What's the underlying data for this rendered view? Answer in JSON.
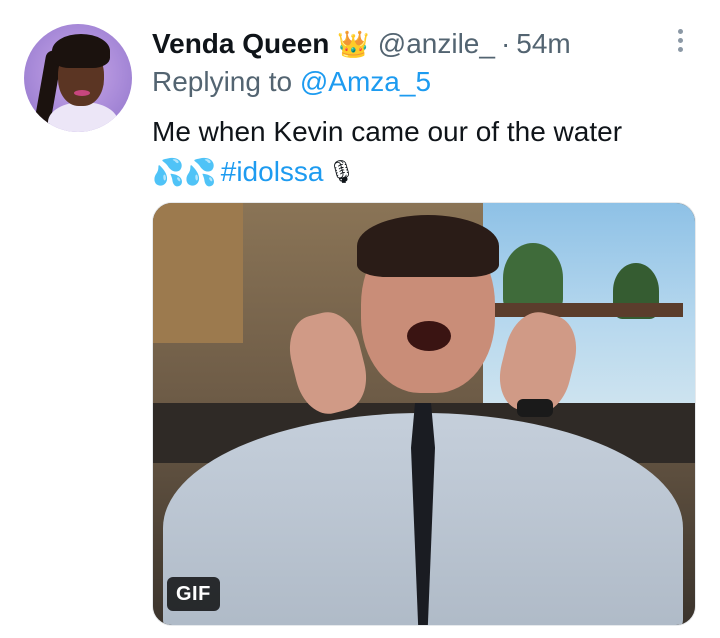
{
  "tweet": {
    "author_name": "Venda Queen",
    "author_badge_emoji": "👑",
    "handle": "@anzile_",
    "separator": "·",
    "time": "54m",
    "replying_prefix": "Replying to",
    "replying_to": "@Amza_5",
    "text_line1": "Me when Kevin came our of the water",
    "emoji_drops": "💦💦",
    "hashtag": "#idolssa",
    "emoji_mic": "🎙",
    "media": {
      "badge": "GIF"
    }
  },
  "icons": {
    "more": "more-vertical-icon",
    "avatar": "avatar-image"
  },
  "colors": {
    "link": "#1d9bf0",
    "secondary_text": "#536471",
    "primary_text": "#0f1419"
  }
}
